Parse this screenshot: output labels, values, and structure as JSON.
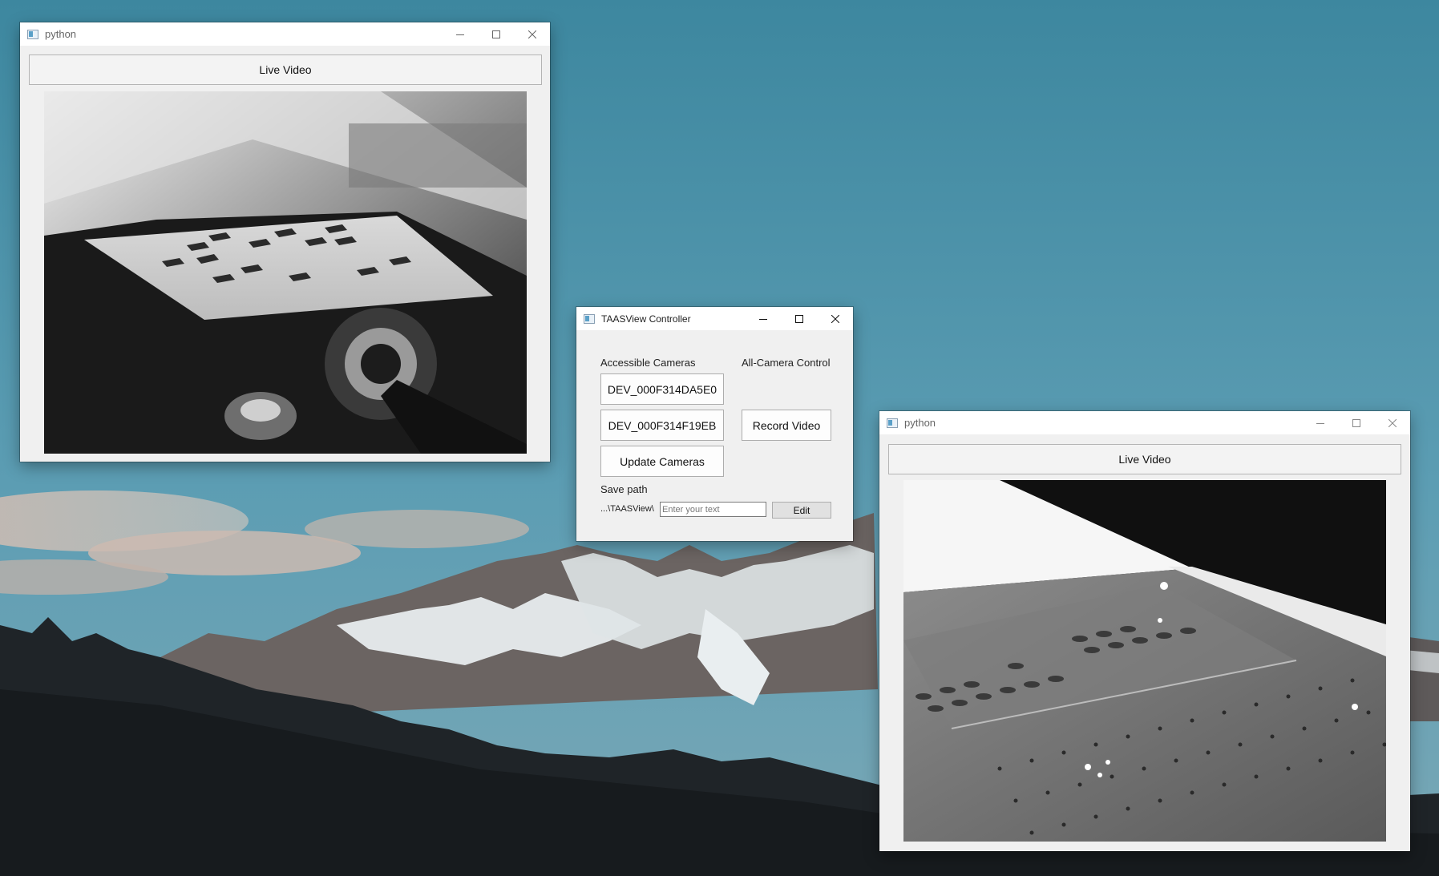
{
  "desktop": {
    "wallpaper": "mountain landscape with blue sky",
    "sky_color": "#4d93ab",
    "forest_color": "#1d2226"
  },
  "windows": {
    "python_left": {
      "title": "python",
      "icon": "python-app-icon",
      "live_video_label": "Live Video",
      "feed": "grayscale camera feed of a sensor module with dark square markers"
    },
    "python_right": {
      "title": "python",
      "icon": "python-app-icon",
      "live_video_label": "Live Video",
      "feed": "grayscale close-up camera feed of a perforated plate"
    },
    "controller": {
      "title": "TAASView Controller",
      "icon": "python-app-icon",
      "accessible_cameras_label": "Accessible Cameras",
      "all_camera_control_label": "All-Camera Control",
      "cameras": [
        "DEV_000F314DA5E0",
        "DEV_000F314F19EB"
      ],
      "update_cameras_label": "Update Cameras",
      "record_video_label": "Record Video",
      "save_path_label": "Save path",
      "save_path_value": "...\\TAASView\\",
      "save_path_placeholder": "Enter your text",
      "edit_label": "Edit"
    }
  },
  "window_controls": {
    "minimize": "minimize-icon",
    "maximize": "maximize-icon",
    "close": "close-icon"
  }
}
